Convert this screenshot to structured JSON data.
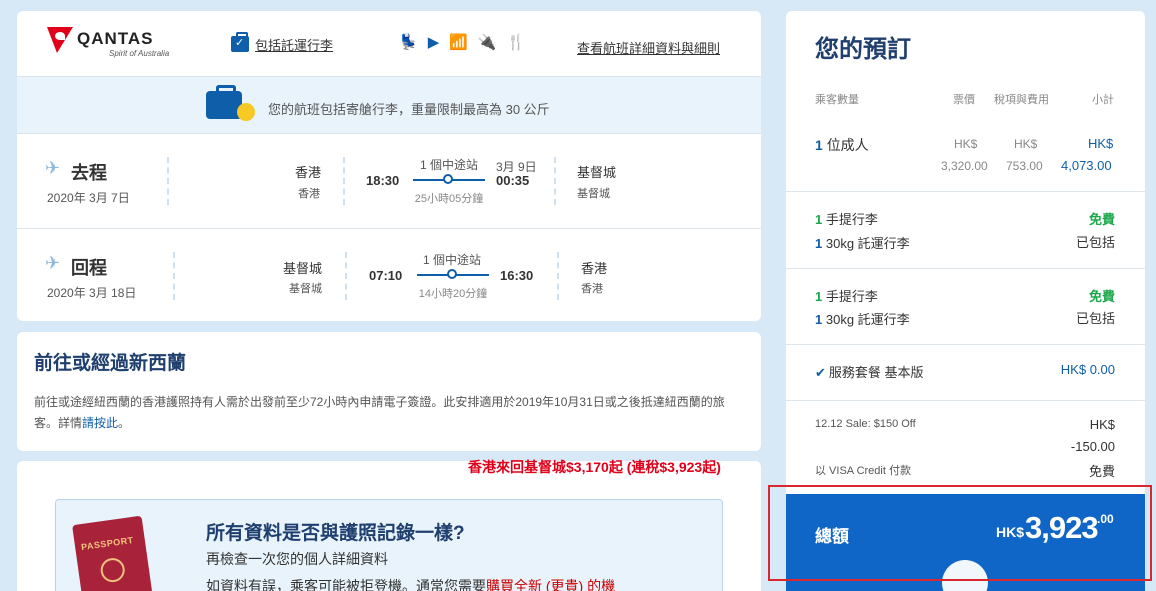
{
  "flight_card": {
    "logo_text": "QANTAS",
    "logo_sub": "Spirit of Australia",
    "bag_link": "包括託運行李",
    "amenity_icons": [
      "seat-icon",
      "entertainment-icon",
      "wifi-icon",
      "power-icon",
      "meal-icon"
    ],
    "amenities_glyphs": [
      "💺",
      "▶",
      "📶",
      "🔌",
      "🍴"
    ],
    "detail_link": "查看航班詳細資料與細則",
    "banner_text": "您的航班包括寄艙行李，重量限制最高為 30 公斤",
    "outbound": {
      "title": "去程",
      "date": "2020年 3月 7日",
      "origin": "香港",
      "origin_sub": "香港",
      "depart_time": "18:30",
      "stops": "1 個中途站",
      "duration": "25小時05分鐘",
      "arrive_date": "3月 9日",
      "arrive_time": "00:35",
      "destination": "基督城",
      "destination_sub": "基督城"
    },
    "return": {
      "title": "回程",
      "date": "2020年 3月 18日",
      "origin": "基督城",
      "origin_sub": "基督城",
      "depart_time": "07:10",
      "stops": "1 個中途站",
      "duration": "14小時20分鐘",
      "arrive_time": "16:30",
      "destination": "香港",
      "destination_sub": "香港"
    }
  },
  "visa_card": {
    "title": "前往或經過新西蘭",
    "body": "前往或途經紐西蘭的香港護照持有人需於出發前至少72小時內申請電子簽證。此安排適用於2019年10月31日或之後抵達紐西蘭的旅客。詳情",
    "link": "請按此",
    "suffix": "。"
  },
  "passport_card": {
    "passport_label": "PASSPORT",
    "title": "所有資料是否與護照記錄一樣?",
    "subtitle": "再檢查一次您的個人詳細資料",
    "warning_prefix": "如資料有誤，乘客可能被拒登機。通常您需要",
    "warning_red": "購買全新 (更貴) 的機"
  },
  "promo_text": "香港來回基督城$3,170起 (連稅$3,923起)",
  "summary": {
    "title": "您的預訂",
    "col_pax": "乘客數量",
    "col_fare": "票價",
    "col_tax": "稅項與費用",
    "col_subtotal": "小計",
    "pax_count": "1",
    "pax_label": "位成人",
    "fare_cur": "HK$",
    "fare": "3,320.00",
    "tax_cur": "HK$",
    "tax": "753.00",
    "sub_cur": "HK$",
    "subtotal": "4,073.00",
    "seg1_carry_count": "1",
    "seg1_carry": "手提行李",
    "seg1_carry_price": "免費",
    "seg1_checked_count": "1",
    "seg1_checked": "30kg 託運行李",
    "seg1_checked_status": "已包括",
    "seg2_carry_count": "1",
    "seg2_carry": "手提行李",
    "seg2_carry_price": "免費",
    "seg2_checked_count": "1",
    "seg2_checked": "30kg 託運行李",
    "seg2_checked_status": "已包括",
    "service": "服務套餐 基本版",
    "service_price": "HK$ 0.00",
    "sale_label": "12.12 Sale: $150 Off",
    "sale_cur": "HK$",
    "sale_amount": "-150.00",
    "visa_pay": "以 VISA Credit 付款",
    "visa_pay_fee": "免費",
    "total_label": "總額",
    "total_cur": "HK$",
    "total_amount": "3,923",
    "total_cents": ".00"
  },
  "colors": {
    "brand_blue": "#0f66c7",
    "qantas_red": "#e1001a",
    "free_green": "#1aa84b",
    "highlight_red": "#d9262f"
  }
}
